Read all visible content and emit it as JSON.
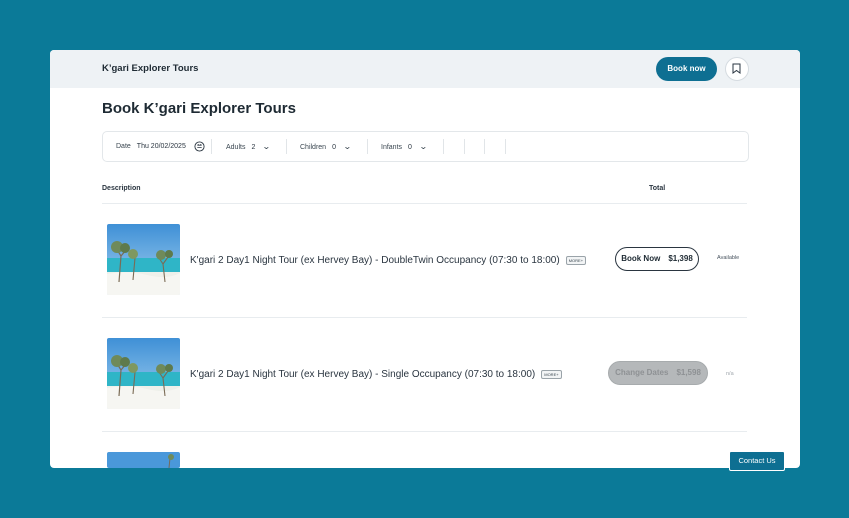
{
  "header": {
    "brand": "K’gari Explorer Tours",
    "book_now_label": "Book now"
  },
  "page": {
    "title": "Book K’gari Explorer Tours"
  },
  "filters": {
    "date_label": "Date",
    "date_value": "Thu 20/02/2025",
    "adults_label": "Adults",
    "adults_value": "2",
    "children_label": "Children",
    "children_value": "0",
    "infants_label": "Infants",
    "infants_value": "0"
  },
  "table": {
    "col_description": "Description",
    "col_total": "Total",
    "rows": [
      {
        "name": "K'gari 2 Day1 Night Tour (ex Hervey Bay) - DoubleTwin Occupancy (07:30 to 18:00)",
        "badge": "MORE+",
        "button_label": "Book Now",
        "price": "$1,398",
        "status": "Available"
      },
      {
        "name": "K'gari 2 Day1 Night Tour (ex Hervey Bay) - Single Occupancy (07:30 to 18:00)",
        "badge": "MORE+",
        "button_label": "Change Dates",
        "price": "$1,598",
        "status": "n/a"
      }
    ]
  },
  "contact_label": "Contact Us",
  "colors": {
    "background": "#0b7a98",
    "accent": "#0e6f92"
  }
}
